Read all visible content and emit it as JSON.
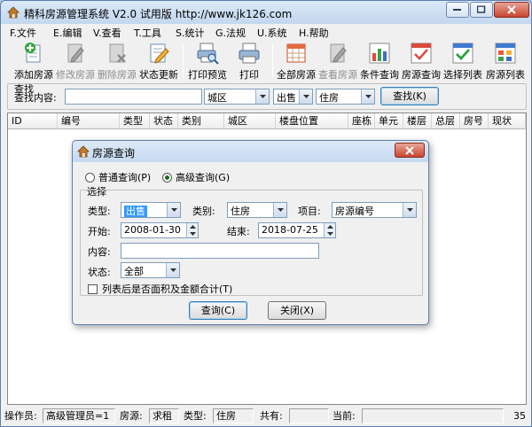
{
  "window": {
    "title": "精科房源管理系统 V2.0  试用版 http://www.jk126.com"
  },
  "menu": [
    {
      "label": "F.文件"
    },
    {
      "label": "E.编辑"
    },
    {
      "label": "V.查看"
    },
    {
      "label": "T.工具"
    },
    {
      "label": "S.统计"
    },
    {
      "label": "G.法规"
    },
    {
      "label": "U.系统"
    },
    {
      "label": "H.帮助"
    }
  ],
  "toolbar": [
    {
      "label": "添加房源",
      "icon": "add-house-icon",
      "enabled": true
    },
    {
      "label": "修改房源",
      "icon": "edit-house-icon",
      "enabled": false
    },
    {
      "label": "删除房源",
      "icon": "delete-house-icon",
      "enabled": false
    },
    {
      "label": "状态更新",
      "icon": "status-update-icon",
      "enabled": true
    },
    {
      "label": "打印预览",
      "icon": "print-preview-icon",
      "enabled": true
    },
    {
      "label": "打印",
      "icon": "printer-icon",
      "enabled": true
    },
    {
      "label": "全部房源",
      "icon": "calendar-grid-icon",
      "enabled": true
    },
    {
      "label": "查看房源",
      "icon": "view-house-icon",
      "enabled": false
    },
    {
      "label": "条件查询",
      "icon": "bar-chart-icon",
      "enabled": true
    },
    {
      "label": "房源查询",
      "icon": "house-search-icon",
      "enabled": true
    },
    {
      "label": "选择列表",
      "icon": "check-list-icon",
      "enabled": true
    },
    {
      "label": "房源列表",
      "icon": "house-list-icon",
      "enabled": true
    }
  ],
  "search": {
    "legend": "查找",
    "content_label": "查找内容:",
    "content_value": "",
    "district": "城区",
    "deal_type": "出售",
    "property_type": "住房",
    "empty_combo": "",
    "button": "查找(K)"
  },
  "grid": {
    "columns": [
      "ID",
      "编号",
      "类型",
      "状态",
      "类别",
      "城区",
      "楼盘位置",
      "座栋",
      "单元",
      "楼层",
      "总层",
      "房号",
      "现状"
    ]
  },
  "status": {
    "operator_label": "操作员:",
    "operator_value": "高级管理员=1",
    "source_label": "房源:",
    "source_value": "求租",
    "type_label": "类型:",
    "type_value": "住房",
    "total_label": "共有:",
    "total_value": "",
    "current_label": "当前:",
    "current_value": "",
    "count": "35"
  },
  "dialog": {
    "title": "房源查询",
    "radio_normal": "普通查询(P)",
    "radio_advanced": "高级查询(G)",
    "selected_mode": "advanced",
    "group_legend": "选择",
    "type_label": "类型:",
    "type_value": "出售",
    "category_label": "类别:",
    "category_value": "住房",
    "item_label": "项目:",
    "item_value": "房源编号",
    "start_label": "开始:",
    "start_value": "2008-01-30",
    "end_label": "结束:",
    "end_value": "2018-07-25",
    "content_label": "内容:",
    "content_value": "",
    "state_label": "状态:",
    "state_value": "全部",
    "checkbox_label": "列表后是否面积及金额合计(T)",
    "checkbox_checked": false,
    "query_button": "查询(C)",
    "close_button": "关闭(X)"
  }
}
